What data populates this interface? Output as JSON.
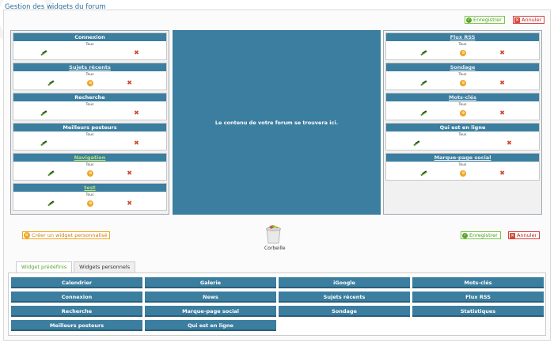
{
  "page": {
    "title": "Gestion des widgets du forum"
  },
  "actions": {
    "save": "Enregistrer",
    "cancel": "Annuler"
  },
  "center": {
    "text": "Le contenu de votre forum se trouvera ici."
  },
  "left_column": [
    {
      "title": "Connexion",
      "link": false,
      "sub": "Tous",
      "has_config": false
    },
    {
      "title": "Sujets récents",
      "link": true,
      "green": false,
      "sub": "Tous",
      "has_config": true
    },
    {
      "title": "Recherche",
      "link": false,
      "sub": "Tous",
      "has_config": false
    },
    {
      "title": "Meilleurs posteurs",
      "link": false,
      "sub": "Tous",
      "has_config": false
    },
    {
      "title": "Navigation",
      "link": true,
      "green": true,
      "sub": "Tous",
      "has_config": true
    },
    {
      "title": "test",
      "link": true,
      "green": true,
      "sub": "Tous",
      "has_config": true
    }
  ],
  "right_column": [
    {
      "title": "Flux RSS",
      "link": true,
      "green": false,
      "sub": "Tous",
      "has_config": true
    },
    {
      "title": "Sondage",
      "link": true,
      "green": false,
      "sub": "Tous",
      "has_config": true
    },
    {
      "title": "Mots-clés",
      "link": true,
      "green": false,
      "sub": "Tous",
      "has_config": true
    },
    {
      "title": "Qui est en ligne",
      "link": false,
      "sub": "Tous",
      "has_config": false
    },
    {
      "title": "Marque-page social",
      "link": true,
      "green": false,
      "sub": "Tous",
      "has_config": true
    }
  ],
  "create_widget": "Créer un widget personnalisé",
  "trash": {
    "label": "Corbeille"
  },
  "tabs": [
    {
      "label": "Widget prédéfinis",
      "active": true
    },
    {
      "label": "Widgets personnels",
      "active": false
    }
  ],
  "library": [
    "Calendrier",
    "Galerie",
    "iGoogle",
    "Mots-clés",
    "Connexion",
    "News",
    "Sujets récents",
    "Flux RSS",
    "Recherche",
    "Marque-page social",
    "Sondage",
    "Statistiques",
    "Meilleurs posteurs",
    "Qui est en ligne"
  ],
  "colors": {
    "widget_header": "#3b7e9f",
    "save": "#5aa52c",
    "cancel": "#d24a36",
    "accent": "#f0a623"
  },
  "icons": {
    "edit": "edit-pencil-icon",
    "delete": "delete-x-icon",
    "config": "config-icon",
    "trash": "trash-bin-icon"
  }
}
